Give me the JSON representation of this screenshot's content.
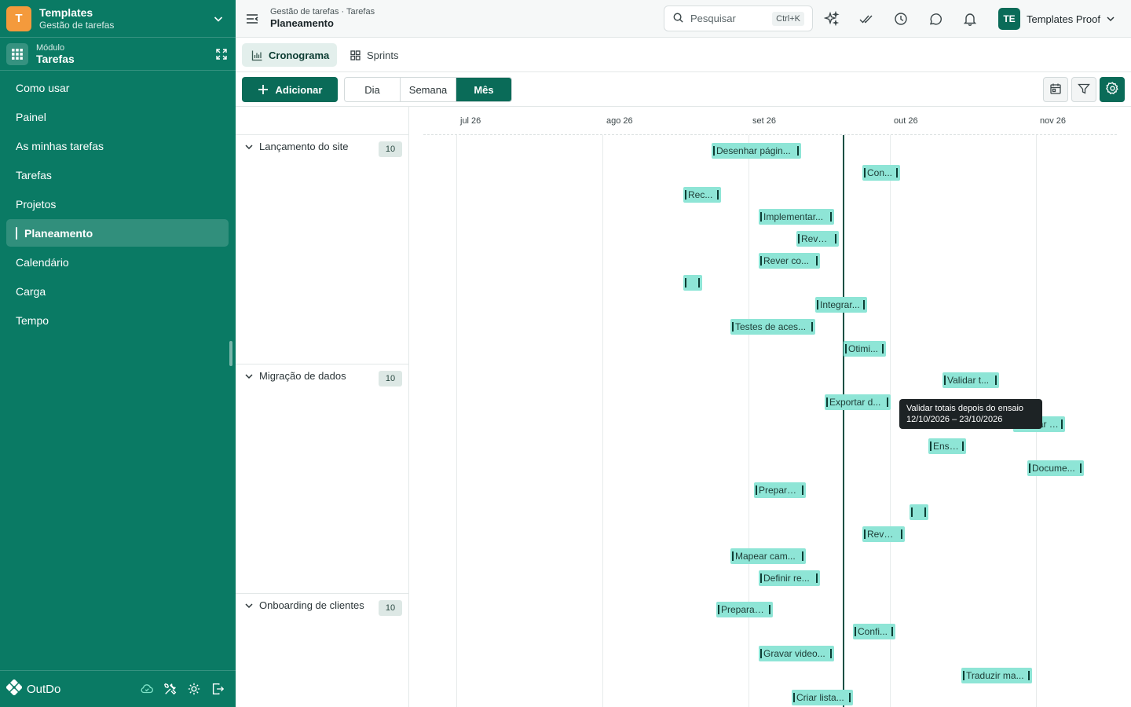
{
  "workspace": {
    "initial": "T",
    "title": "Templates",
    "subtitle": "Gestão de tarefas"
  },
  "module": {
    "label": "Módulo",
    "name": "Tarefas"
  },
  "nav": [
    {
      "label": "Como usar"
    },
    {
      "label": "Painel"
    },
    {
      "label": "As minhas tarefas"
    },
    {
      "label": "Tarefas"
    },
    {
      "label": "Projetos"
    },
    {
      "label": "Planeamento",
      "active": true
    },
    {
      "label": "Calendário"
    },
    {
      "label": "Carga"
    },
    {
      "label": "Tempo"
    }
  ],
  "footer": {
    "brand": "OutDo"
  },
  "header": {
    "breadcrumb": "Gestão de tarefas · Tarefas",
    "page": "Planeamento",
    "search": {
      "placeholder": "Pesquisar",
      "shortcut": "Ctrl+K"
    },
    "user": {
      "initials": "TE",
      "name": "Templates Proof"
    }
  },
  "views": [
    {
      "label": "Cronograma",
      "icon": "bar-chart-icon",
      "active": true
    },
    {
      "label": "Sprints",
      "icon": "grid-icon"
    }
  ],
  "toolbar": {
    "add_label": "Adicionar",
    "scales": [
      {
        "label": "Dia"
      },
      {
        "label": "Semana"
      },
      {
        "label": "Mês",
        "active": true
      }
    ]
  },
  "timeline": {
    "months": [
      "jul 26",
      "ago 26",
      "set 26",
      "out 26",
      "nov 26"
    ]
  },
  "groups": [
    {
      "title": "Lançamento do site",
      "count": "10",
      "tasks": [
        "Desenhar págin...",
        "Con...",
        "Rec...",
        "Implementar...",
        "Rever...",
        "Rever co...",
        "",
        "Integrar...",
        "Testes de aces...",
        "Otimi..."
      ]
    },
    {
      "title": "Migração de dados",
      "count": "10",
      "tasks": [
        "Validar t...",
        "Exportar d...",
        "Validar d...",
        "Ensa...",
        "Docume...",
        "Prepara...",
        "",
        "Rever...",
        "Mapear cam...",
        "Definir re..."
      ]
    },
    {
      "title": "Onboarding de clientes",
      "count": "10",
      "tasks": [
        "Preparar ...",
        "Confi...",
        "Gravar video...",
        "Traduzir ma...",
        "Criar lista..."
      ]
    }
  ],
  "tooltip": {
    "title": "Validar totais depois do ensaio",
    "dates": "12/10/2026 – 23/10/2026"
  },
  "colors": {
    "sidebar": "#0a7a64",
    "accent": "#0a6b58",
    "bar": "#8ee5d6",
    "today": "#0c4f43",
    "workspace_badge": "#f49a3c"
  }
}
